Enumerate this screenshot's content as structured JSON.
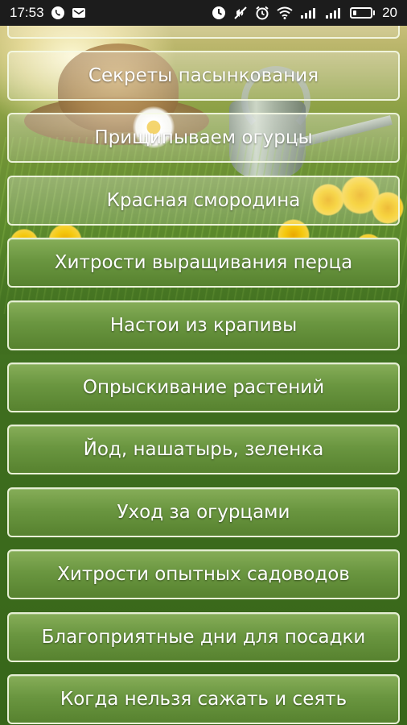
{
  "status_bar": {
    "time": "17:53",
    "battery_level": "20",
    "battery_fraction": 0.2,
    "left_icons": [
      "viber-icon",
      "mail-icon"
    ],
    "right_icons": [
      "sync-icon",
      "mute-icon",
      "alarm-icon",
      "wifi-icon",
      "signal-icon",
      "signal-icon",
      "battery-icon"
    ]
  },
  "menu": {
    "items": [
      {
        "label": ""
      },
      {
        "label": "Секреты пасынкования"
      },
      {
        "label": "Прищипываем огурцы"
      },
      {
        "label": "Красная смородина"
      },
      {
        "label": "Хитрости выращивания перца"
      },
      {
        "label": "Настои из крапивы"
      },
      {
        "label": "Опрыскивание растений"
      },
      {
        "label": "Йод, нашатырь, зеленка"
      },
      {
        "label": "Уход за огурцами"
      },
      {
        "label": "Хитрости опытных садоводов"
      },
      {
        "label": "Благоприятные дни для посадки"
      },
      {
        "label": "Когда нельзя сажать и сеять"
      }
    ]
  },
  "colors": {
    "button_green": "#6a9640",
    "button_border": "#f5fae6",
    "status_bar": "#1c1c1c"
  }
}
